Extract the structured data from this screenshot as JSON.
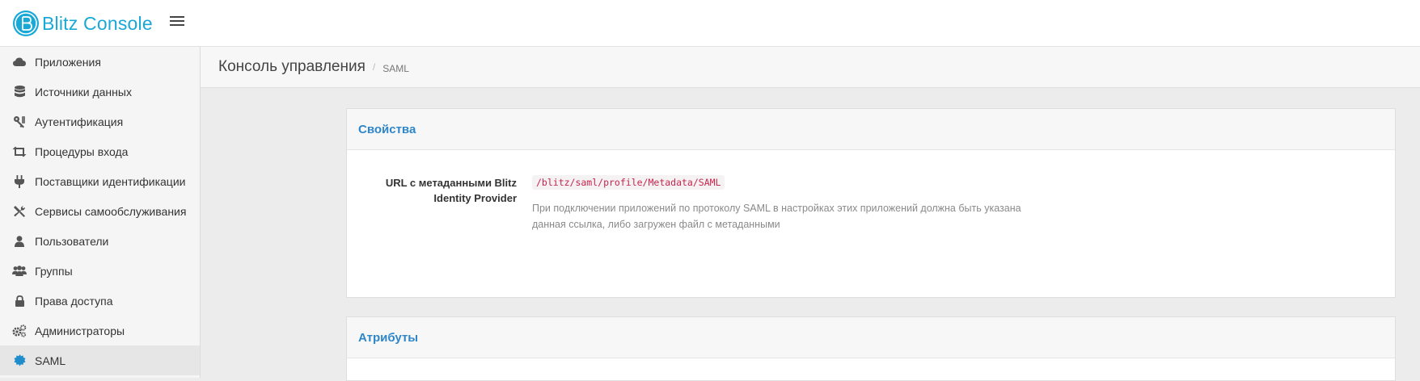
{
  "app": {
    "title": "Blitz Console",
    "accent_color": "#1aa8d6",
    "logo_icon": "blitz-logo-icon",
    "menu_icon": "hamburger-icon"
  },
  "sidebar": {
    "items": [
      {
        "label": "Приложения",
        "icon": "cloud-icon"
      },
      {
        "label": "Источники данных",
        "icon": "database-icon"
      },
      {
        "label": "Аутентификация",
        "icon": "key-icon"
      },
      {
        "label": "Процедуры входа",
        "icon": "retweet-icon"
      },
      {
        "label": "Поставщики идентификации",
        "icon": "plug-icon"
      },
      {
        "label": "Сервисы самообслуживания",
        "icon": "tools-icon"
      },
      {
        "label": "Пользователи",
        "icon": "user-icon"
      },
      {
        "label": "Группы",
        "icon": "users-icon"
      },
      {
        "label": "Права доступа",
        "icon": "lock-icon"
      },
      {
        "label": "Администраторы",
        "icon": "gears-icon"
      },
      {
        "label": "SAML",
        "icon": "certificate-icon",
        "active": true
      }
    ]
  },
  "header": {
    "title": "Консоль управления",
    "separator": "/",
    "breadcrumb": "SAML"
  },
  "properties_card": {
    "title": "Свойства",
    "title_color": "#2f86c9",
    "row": {
      "label": "URL с метаданными Blitz Identity Provider",
      "value": "/blitz/saml/profile/Metadata/SAML",
      "help": "При подключении приложений по протоколу SAML в настройках этих приложений должна быть указана данная ссылка, либо загружен файл с метаданными"
    }
  },
  "attributes_card": {
    "title": "Атрибуты"
  }
}
